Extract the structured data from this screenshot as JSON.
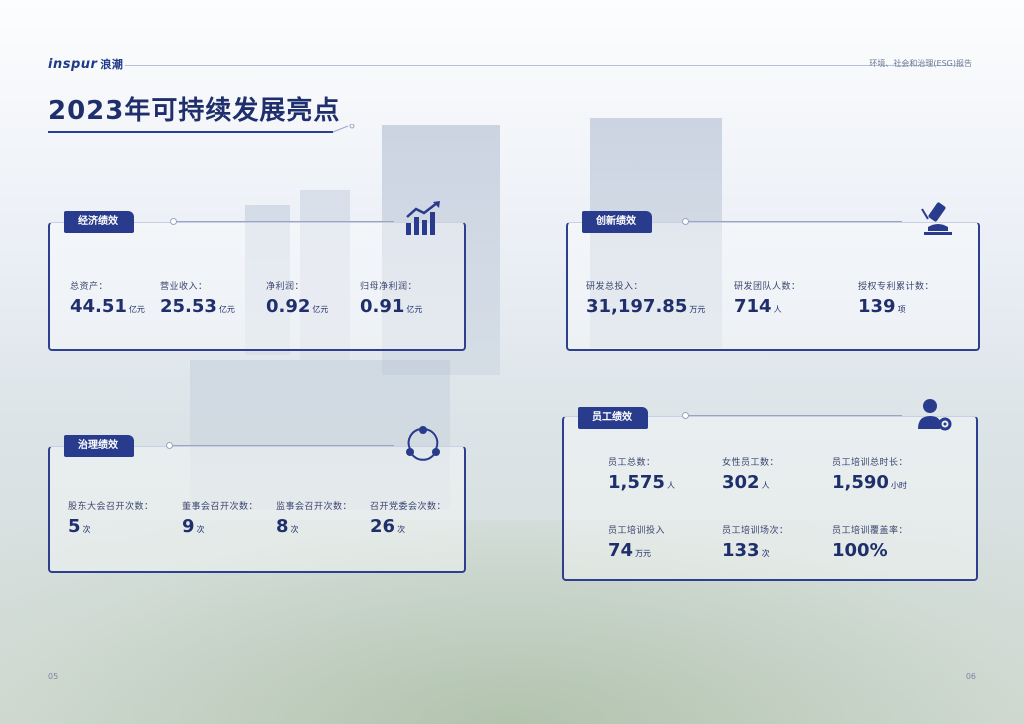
{
  "header": {
    "logo_en": "inspur",
    "logo_cn": "浪潮",
    "report_name": "环境、社会和治理(ESG)报告"
  },
  "page_title": "2023年可持续发展亮点",
  "theme": {
    "primary": "#283b8c",
    "text": "#1f2f6b"
  },
  "cards": {
    "economic": {
      "tab": "经济绩效",
      "icon": "bar-chart-growth-icon",
      "metrics": [
        {
          "label": "总资产：",
          "value": "44.51",
          "unit": "亿元"
        },
        {
          "label": "营业收入：",
          "value": "25.53",
          "unit": "亿元"
        },
        {
          "label": "净利润：",
          "value": "0.92",
          "unit": "亿元"
        },
        {
          "label": "归母净利润：",
          "value": "0.91",
          "unit": "亿元"
        }
      ]
    },
    "innovation": {
      "tab": "创新绩效",
      "icon": "microscope-icon",
      "metrics": [
        {
          "label": "研发总投入：",
          "value": "31,197.85",
          "unit": "万元"
        },
        {
          "label": "研发团队人数：",
          "value": "714",
          "unit": "人"
        },
        {
          "label": "授权专利累计数：",
          "value": "139",
          "unit": "项"
        }
      ]
    },
    "governance": {
      "tab": "治理绩效",
      "icon": "network-nodes-icon",
      "metrics": [
        {
          "label": "股东大会召开次数：",
          "value": "5",
          "unit": "次"
        },
        {
          "label": "董事会召开次数：",
          "value": "9",
          "unit": "次"
        },
        {
          "label": "监事会召开次数：",
          "value": "8",
          "unit": "次"
        },
        {
          "label": "召开党委会次数：",
          "value": "26",
          "unit": "次"
        }
      ]
    },
    "employee": {
      "tab": "员工绩效",
      "icon": "user-gear-icon",
      "metrics": [
        {
          "label": "员工总数：",
          "value": "1,575",
          "unit": "人"
        },
        {
          "label": "女性员工数：",
          "value": "302",
          "unit": "人"
        },
        {
          "label": "员工培训总时长：",
          "value": "1,590",
          "unit": "小时"
        },
        {
          "label": "员工培训投入",
          "value": "74",
          "unit": "万元"
        },
        {
          "label": "员工培训场次：",
          "value": "133",
          "unit": "次"
        },
        {
          "label": "员工培训覆盖率：",
          "value": "100%",
          "unit": ""
        }
      ]
    }
  },
  "page_numbers": {
    "left": "05",
    "right": "06"
  }
}
